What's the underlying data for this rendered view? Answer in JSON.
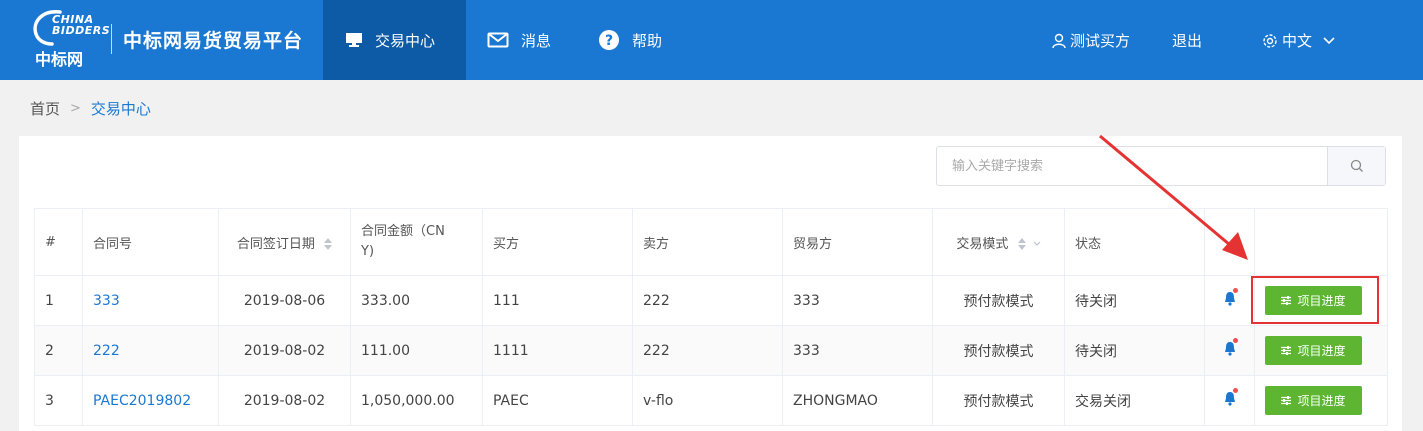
{
  "header": {
    "logo_en": "CHINA BIDDERS",
    "logo_cn": "中标网",
    "platform_title": "中标网易货贸易平台",
    "nav": [
      {
        "label": "交易中心",
        "icon": "monitor-icon",
        "active": true
      },
      {
        "label": "消息",
        "icon": "mail-icon",
        "active": false
      },
      {
        "label": "帮助",
        "icon": "help-icon",
        "active": false
      }
    ],
    "user_label": "测试买方",
    "logout_label": "退出",
    "language_label": "中文",
    "bg_color": "#1a78d2",
    "active_nav_color": "#0d5aa7"
  },
  "breadcrumb": {
    "home": "首页",
    "current": "交易中心"
  },
  "search": {
    "placeholder": "输入关键字搜索",
    "value": ""
  },
  "table": {
    "columns": [
      "#",
      "合同号",
      "合同签订日期",
      "合同金额（CNY)",
      "买方",
      "卖方",
      "贸易方",
      "交易模式",
      "状态",
      "",
      ""
    ],
    "amount_header_line1": "合同金额（CN",
    "amount_header_line2": "Y)",
    "rows": [
      {
        "index": "1",
        "contract_no": "333",
        "date": "2019-08-06",
        "amount": "333.00",
        "buyer": "111",
        "seller": "222",
        "trader": "333",
        "mode": "预付款模式",
        "status": "待关闭",
        "action": "项目进度"
      },
      {
        "index": "2",
        "contract_no": "222",
        "date": "2019-08-02",
        "amount": "111.00",
        "buyer": "1111",
        "seller": "222",
        "trader": "333",
        "mode": "预付款模式",
        "status": "待关闭",
        "action": "项目进度"
      },
      {
        "index": "3",
        "contract_no": "PAEC2019802",
        "date": "2019-08-02",
        "amount": "1,050,000.00",
        "buyer": "PAEC",
        "seller": "v-flo",
        "trader": "ZHONGMAO",
        "mode": "预付款模式",
        "status": "交易关闭",
        "action": "项目进度"
      }
    ]
  },
  "colors": {
    "link": "#1a78d2",
    "green": "#5db531",
    "annotation_red": "#e53333"
  }
}
